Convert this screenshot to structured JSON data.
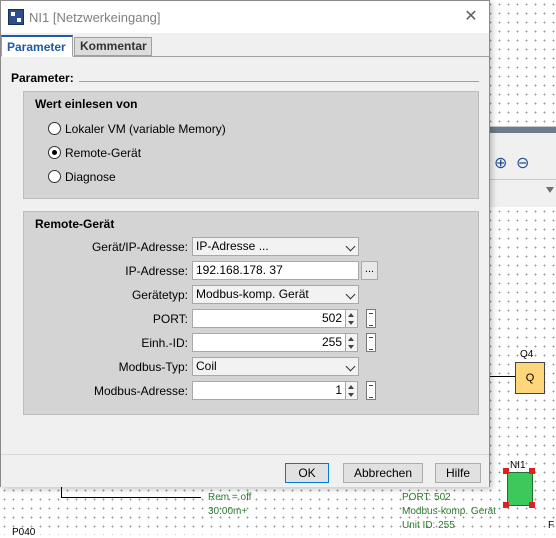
{
  "window": {
    "title": "NI1 [Netzwerkeingang]",
    "close_glyph": "✕"
  },
  "tabs": [
    {
      "label": "Parameter",
      "active": true
    },
    {
      "label": "Kommentar",
      "active": false
    }
  ],
  "parameters": {
    "heading": "Parameter:"
  },
  "source_group": {
    "title": "Wert einlesen von",
    "options": [
      {
        "label": "Lokaler VM (variable Memory)",
        "checked": false
      },
      {
        "label": "Remote-Gerät",
        "checked": true
      },
      {
        "label": "Diagnose",
        "checked": false
      }
    ]
  },
  "remote_group": {
    "title": "Remote-Gerät",
    "device_ip": {
      "label": "Gerät/IP-Adresse:",
      "value": "IP-Adresse ..."
    },
    "ip_address": {
      "label": "IP-Adresse:",
      "value": "192.168.178. 37",
      "browse": "..."
    },
    "device_type": {
      "label": "Gerätetyp:",
      "value": "Modbus-komp. Gerät"
    },
    "port": {
      "label": "PORT:",
      "value": "502"
    },
    "unit_id": {
      "label": "Einh.-ID:",
      "value": "255"
    },
    "modbus_type": {
      "label": "Modbus-Typ:",
      "value": "Coil"
    },
    "modbus_address": {
      "label": "Modbus-Adresse:",
      "value": "1"
    }
  },
  "buttons": {
    "ok": "OK",
    "cancel": "Abbrechen",
    "help": "Hilfe"
  },
  "background": {
    "q4_label": "Q4",
    "q4_block": "Q",
    "ni1_label": "NI1",
    "notes": {
      "rem_off": "Rem = off",
      "time": "30:00m+",
      "port": "PORT: 502",
      "modbus": "Modbus-komp. Gerät",
      "unit": "Unit ID: 255",
      "p040": "P040",
      "f": "F"
    },
    "toolbar_icons": [
      "zoom-in-icon",
      "zoom-out-icon"
    ]
  }
}
